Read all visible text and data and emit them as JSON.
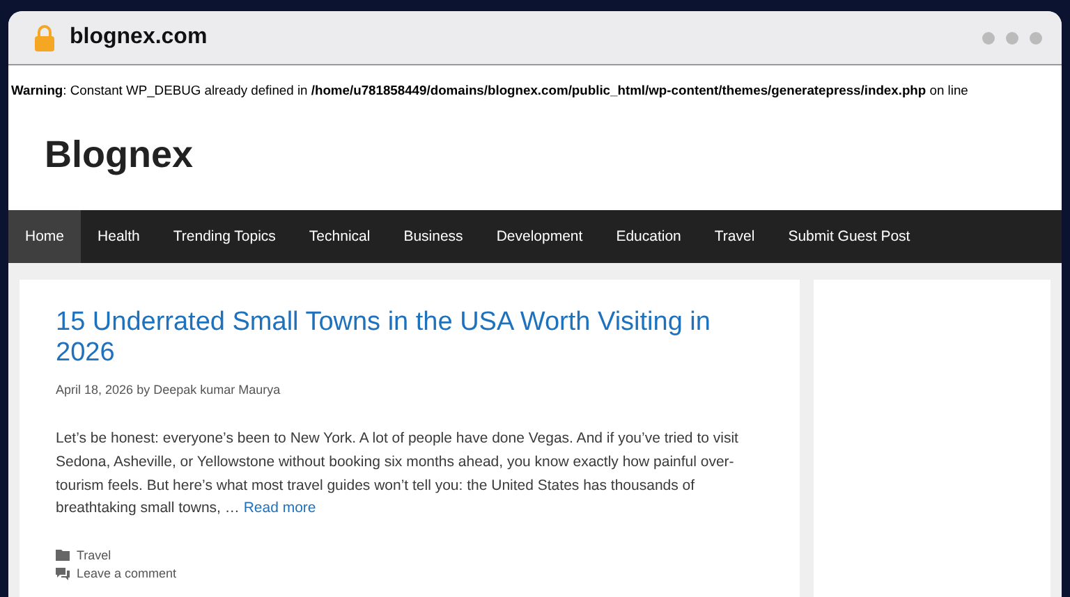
{
  "browser": {
    "address": "blognex.com"
  },
  "warning": {
    "label": "Warning",
    "message": ": Constant WP_DEBUG already defined in ",
    "path": "/home/u781858449/domains/blognex.com/public_html/wp-content/themes/generatepress/index.php",
    "tail": " on line"
  },
  "site_title": "Blognex",
  "nav": [
    {
      "label": "Home",
      "selected": true
    },
    {
      "label": "Health",
      "selected": false
    },
    {
      "label": "Trending Topics",
      "selected": false
    },
    {
      "label": "Technical",
      "selected": false
    },
    {
      "label": "Business",
      "selected": false
    },
    {
      "label": "Development",
      "selected": false
    },
    {
      "label": "Education",
      "selected": false
    },
    {
      "label": "Travel",
      "selected": false
    },
    {
      "label": "Submit Guest Post",
      "selected": false
    }
  ],
  "post": {
    "title": "15 Underrated Small Towns in the USA Worth Visiting in 2026",
    "date": "April 18, 2026",
    "byline": "by",
    "author": "Deepak kumar Maurya",
    "excerpt": "Let’s be honest: everyone’s been to New York. A lot of people have done Vegas. And if you’ve tried to visit Sedona, Asheville, or Yellowstone without booking six months ahead, you know exactly how painful over-tourism feels. But here’s what most travel guides won’t tell you: the United States has thousands of breathtaking small towns, …",
    "read_more": "Read more",
    "category": "Travel",
    "comments": "Leave a comment"
  }
}
